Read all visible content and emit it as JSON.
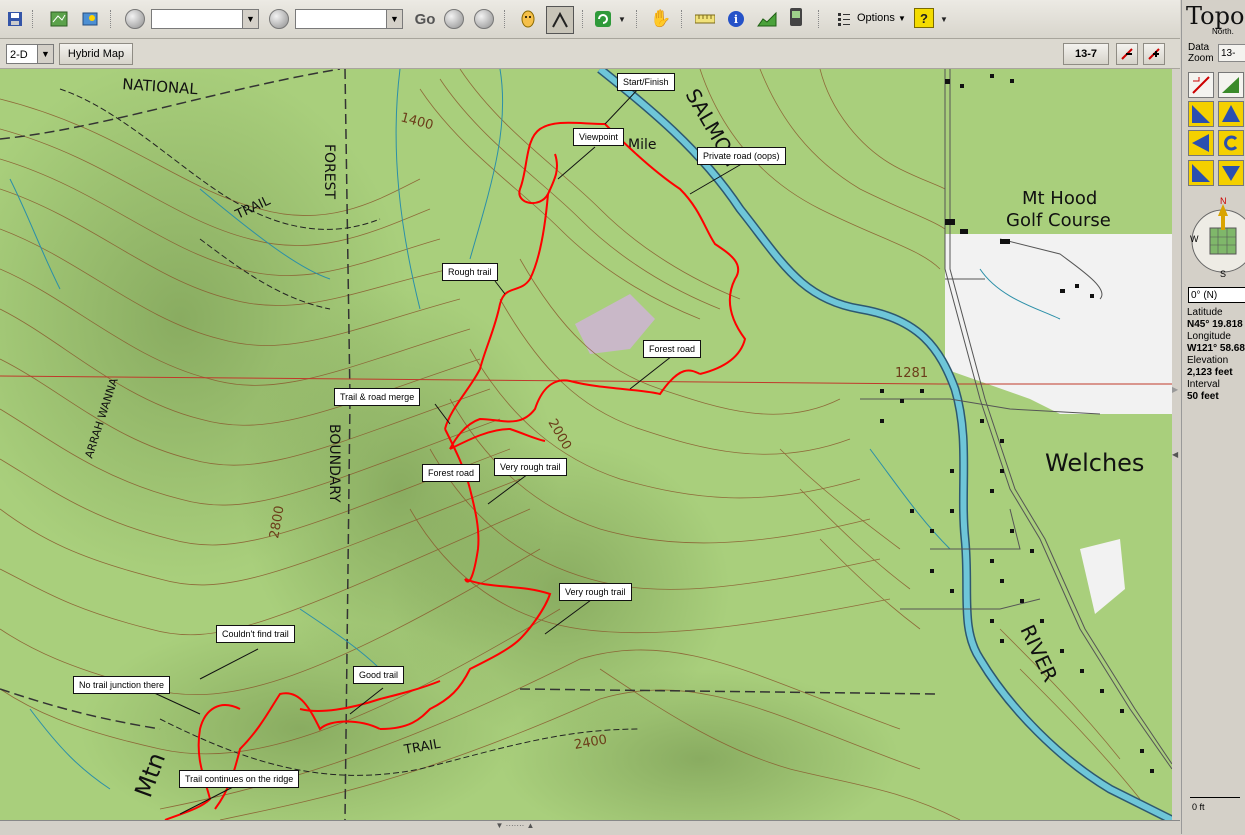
{
  "toolbar": {
    "go_label": "Go",
    "options_label": "Options",
    "help_label": "?",
    "combo1_value": "",
    "combo2_value": ""
  },
  "viewbar": {
    "mode_value": "2-D",
    "hybrid_label": "Hybrid Map",
    "zoom_value": "13-7"
  },
  "map": {
    "texts": {
      "national": "NATIONAL",
      "forest": "FOREST",
      "boundary": "BOUNDARY",
      "trail1": "TRAIL",
      "trail2": "TRAIL",
      "hunchback": "ARRAH WANNA",
      "c1400": "1400",
      "c2000": "2000",
      "c2800": "2800",
      "c2400": "2400",
      "c1281": "1281",
      "mile": "Mile",
      "salmon": "SALMON",
      "river": "RIVER",
      "golf1": "Mt Hood",
      "golf2": "Golf Course",
      "welches": "Welches",
      "mtn": "Mtn"
    },
    "labels": [
      "Start/Finish",
      "Viewpoint",
      "Private road (oops)",
      "Rough trail",
      "Forest road",
      "Trail & road merge",
      "Forest road",
      "Very rough trail",
      "Very rough trail",
      "Couldn't find trail",
      "No trail junction there",
      "Good trail",
      "Trail continues on the ridge"
    ]
  },
  "panel": {
    "title": "Topo",
    "subtitle": "North.",
    "data_label": "Data",
    "zoom_label": "Zoom",
    "zoom_tab": "13-",
    "heading_value": "0° (N)",
    "compass_n": "N",
    "compass_w": "W",
    "compass_s": "S",
    "lat_label": "Latitude",
    "lat_value": "N45° 19.818",
    "lon_label": "Longitude",
    "lon_value": "W121° 58.68",
    "elev_label": "Elevation",
    "elev_value": "2,123 feet",
    "interval_label": "Interval",
    "interval_value": "50 feet",
    "scale_value": "0 ft"
  },
  "colors": {
    "track": "#ff0000",
    "river": "#6ec6d8",
    "terrain": "#a9cf7c",
    "contour": "#8a5a2e"
  }
}
